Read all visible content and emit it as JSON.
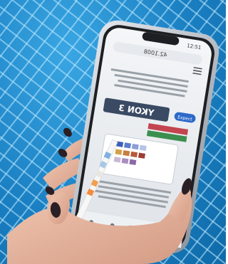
{
  "photo": {
    "subject": "hand-holding-phone-and-test-strip",
    "colors": {
      "pool_water": "#1d86c9",
      "tile_grout": "#bfe9ff",
      "phone_frame": "#c9ced6",
      "skin": "#e7b7a0",
      "nail_polish": "#2a1f24"
    }
  },
  "phone_screen": {
    "status_time": "12:51",
    "url": "42.1008",
    "page_heading_mirrored": "YKON 3",
    "badge": "Expect"
  }
}
